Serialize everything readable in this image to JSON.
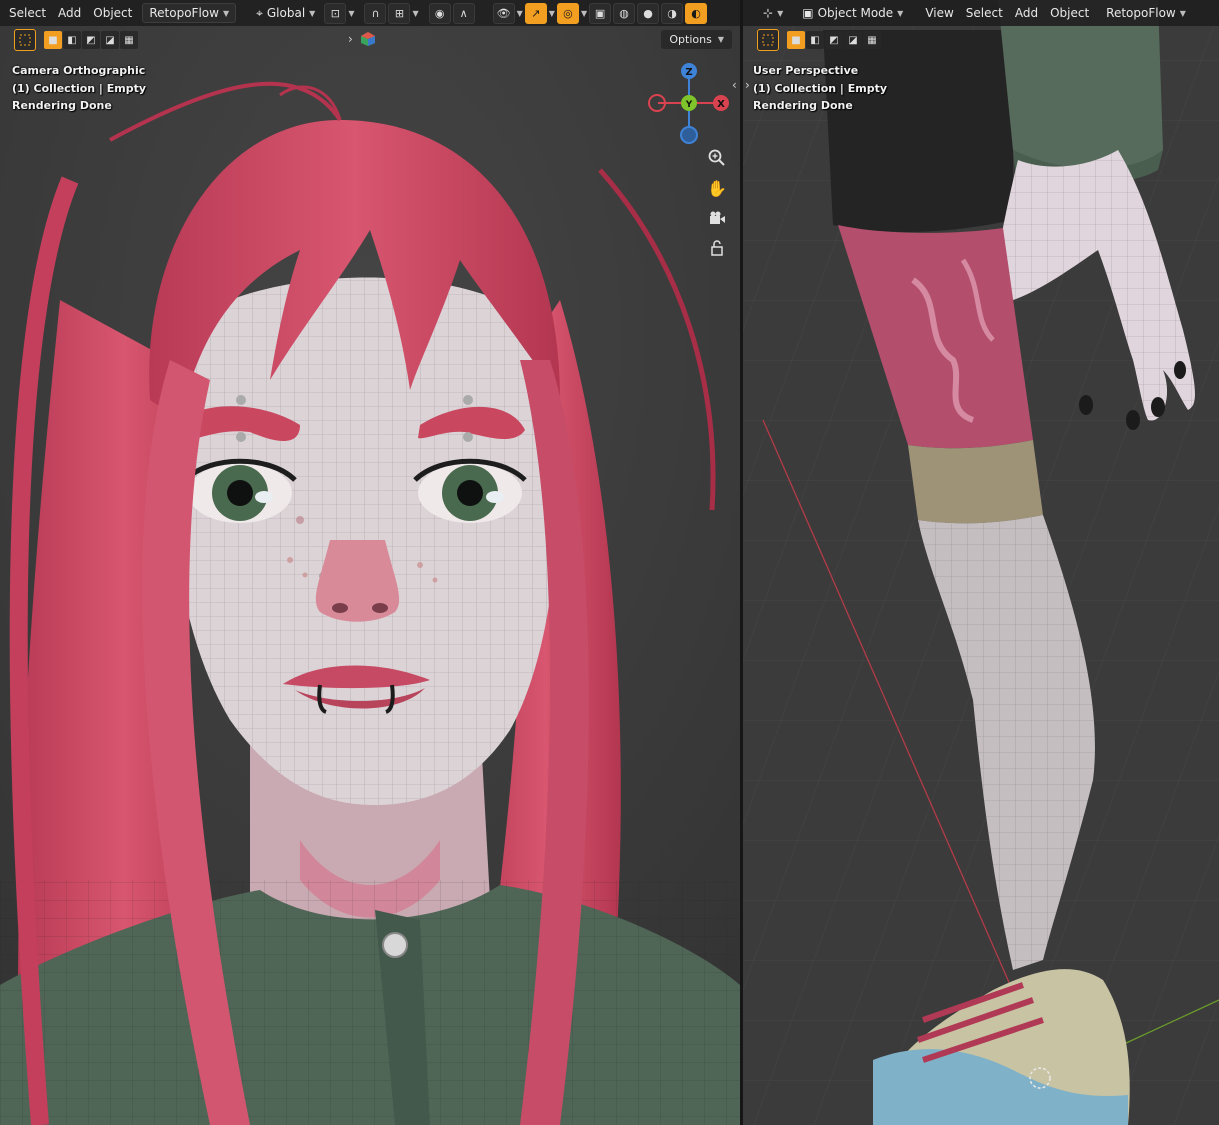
{
  "left_viewport": {
    "header": {
      "menus": [
        "Select",
        "Add",
        "Object"
      ],
      "addon_dropdown": "RetopoFlow",
      "transform_orientation": "Global",
      "icons": [
        "pivot-point-icon",
        "snap-magnet-icon",
        "snap-target-icon",
        "proportional-edit-icon",
        "falloff-icon",
        "visibility-icon",
        "gizmo-icon",
        "overlay-icon",
        "xray-icon",
        "shading-wireframe-icon",
        "shading-solid-icon",
        "shading-material-icon",
        "shading-rendered-icon"
      ]
    },
    "options_label": "Options",
    "overlay": {
      "view_name": "Camera Orthographic",
      "collection": "(1) Collection | Empty",
      "status": "Rendering Done"
    },
    "gizmo": {
      "z": "Z",
      "y": "Y",
      "x": "X"
    }
  },
  "right_viewport": {
    "header": {
      "mode": "Object Mode",
      "menus": [
        "View",
        "Select",
        "Add",
        "Object"
      ],
      "addon_dropdown": "RetopoFlow"
    },
    "overlay": {
      "view_name": "User Perspective",
      "collection": "(1) Collection | Empty",
      "status": "Rendering Done"
    }
  },
  "colors": {
    "accent": "#f29e20",
    "hair": "#c9475f",
    "skin": "#d9d0d4",
    "jacket": "#4f6657",
    "x_axis": "#d9434f",
    "y_axis": "#7ec42a",
    "z_axis": "#3f83d9"
  }
}
